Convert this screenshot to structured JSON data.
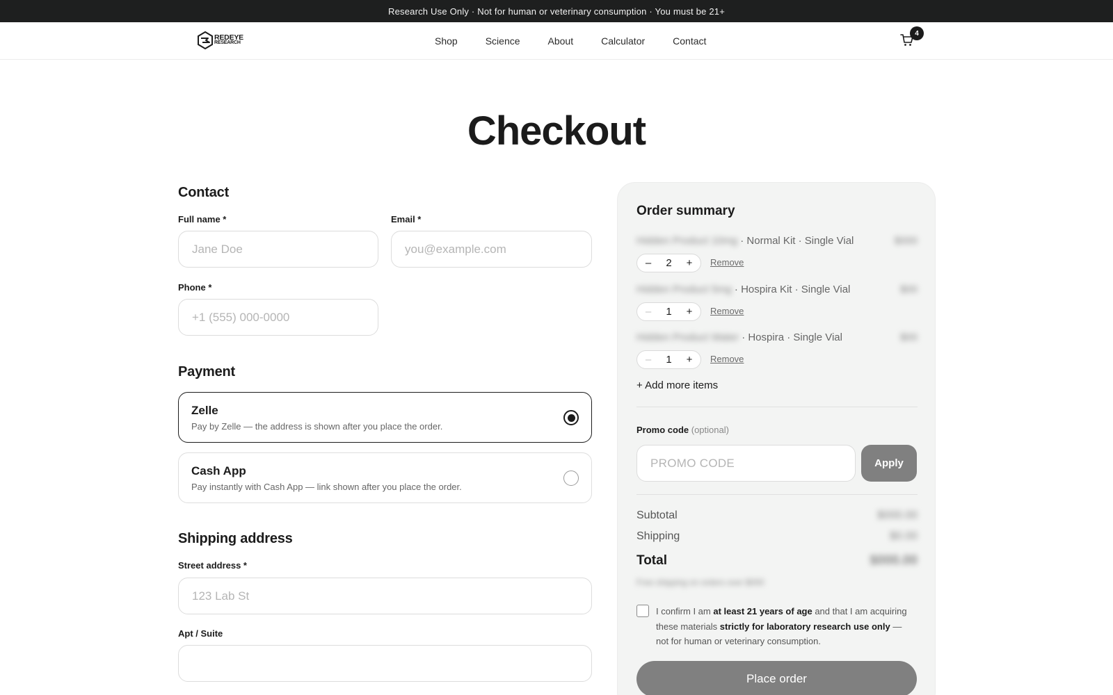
{
  "banner": {
    "text": "Research Use Only · Not for human or veterinary consumption · You must be 21+"
  },
  "brand": {
    "line1": "REDEYE",
    "line2": "RESEARCH"
  },
  "nav": {
    "items": [
      "Shop",
      "Science",
      "About",
      "Calculator",
      "Contact"
    ]
  },
  "cart": {
    "count": "4",
    "icon": "cart-icon"
  },
  "page": {
    "title": "Checkout"
  },
  "contact": {
    "title": "Contact",
    "full_name": {
      "label": "Full name *",
      "placeholder": "Jane Doe"
    },
    "email": {
      "label": "Email *",
      "placeholder": "you@example.com"
    },
    "phone": {
      "label": "Phone *",
      "placeholder": "+1 (555) 000-0000"
    }
  },
  "payment": {
    "title": "Payment",
    "options": [
      {
        "name": "Zelle",
        "desc": "Pay by Zelle — the address is shown after you place the order.",
        "selected": true
      },
      {
        "name": "Cash App",
        "desc": "Pay instantly with Cash App — link shown after you place the order.",
        "selected": false
      }
    ]
  },
  "shipping": {
    "title": "Shipping address",
    "street": {
      "label": "Street address *",
      "placeholder": "123 Lab St"
    },
    "apt": {
      "label": "Apt / Suite",
      "placeholder": ""
    }
  },
  "summary": {
    "title": "Order summary",
    "items": [
      {
        "name": "Hidden Product 10mg",
        "variant": "· Normal Kit · Single Vial",
        "price": "$000",
        "qty": "2",
        "minus": "–",
        "plus": "+",
        "remove": "Remove"
      },
      {
        "name": "Hidden Product 5mg",
        "variant": "· Hospira Kit · Single Vial",
        "price": "$00",
        "qty": "1",
        "minus": "–",
        "plus": "+",
        "remove": "Remove"
      },
      {
        "name": "Hidden Product Water",
        "variant": "· Hospira · Single Vial",
        "price": "$00",
        "qty": "1",
        "minus": "–",
        "plus": "+",
        "remove": "Remove"
      }
    ],
    "add_more": "+ Add more items",
    "promo": {
      "label": "Promo code",
      "optional": "(optional)",
      "placeholder": "PROMO CODE",
      "apply": "Apply"
    },
    "subtotal": {
      "label": "Subtotal",
      "value": "$000.00"
    },
    "shipping": {
      "label": "Shipping",
      "value": "$0.00"
    },
    "total": {
      "label": "Total",
      "value": "$000.00"
    },
    "note": "Free shipping on orders over $000",
    "agree": {
      "t1": "I confirm I am ",
      "b1": "at least 21 years of age",
      "t2": " and that I am acquiring these materials ",
      "b2": "strictly for laboratory research use only",
      "t3": " — not for human or veterinary consumption."
    },
    "place_order": "Place order"
  }
}
